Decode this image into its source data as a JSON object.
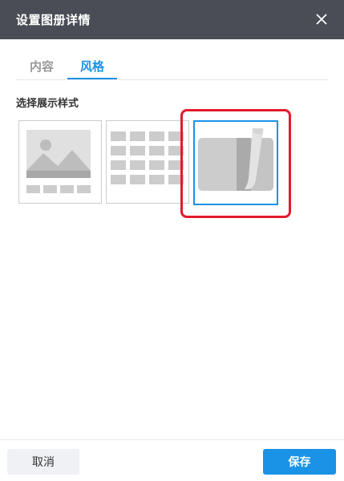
{
  "dialog": {
    "title": "设置图册详情",
    "close_icon": "close-icon"
  },
  "tabs": [
    {
      "label": "内容",
      "active": false
    },
    {
      "label": "风格",
      "active": true
    }
  ],
  "section": {
    "label": "选择展示样式"
  },
  "styles": [
    {
      "icon": "single-image-icon",
      "selected": false
    },
    {
      "icon": "grid-layout-icon",
      "selected": false
    },
    {
      "icon": "album-book-icon",
      "selected": true
    }
  ],
  "footer": {
    "cancel_label": "取消",
    "save_label": "保存"
  },
  "colors": {
    "accent": "#1a93e6",
    "titlebar": "#4a4d55",
    "highlight": "#e21b2c"
  }
}
